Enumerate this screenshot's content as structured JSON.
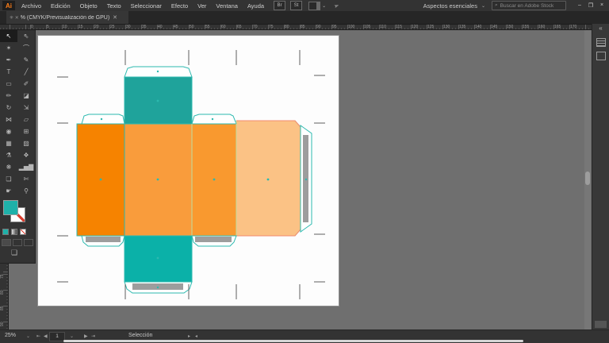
{
  "app": {
    "logo": "Ai"
  },
  "menubar": {
    "items": [
      "Archivo",
      "Edición",
      "Objeto",
      "Texto",
      "Seleccionar",
      "Efecto",
      "Ver",
      "Ventana",
      "Ayuda"
    ],
    "bridge_label": "Br",
    "stock_label": "St",
    "share_glyph": "➣",
    "workspace_chevron": "⌄"
  },
  "workspace": {
    "label": "Aspectos esenciales"
  },
  "search": {
    "magnifier_glyph": "⌕",
    "placeholder": "Buscar en Adobe Stock"
  },
  "window_controls": {
    "minimize": "–",
    "restore": "❐",
    "close": "×"
  },
  "tab": {
    "prefix": "✳ ✕",
    "title": "% (CMYK/Previsualización de GPU)",
    "close": "✕"
  },
  "rulers": {
    "horizontal": [
      0,
      5,
      10,
      15,
      20,
      25,
      30,
      35,
      40,
      45,
      50,
      55,
      60,
      65,
      70,
      75,
      80,
      85,
      90,
      95,
      100,
      105,
      110,
      115,
      120,
      125,
      130,
      135,
      140,
      145,
      150,
      155,
      160,
      165,
      170
    ],
    "vertical": [
      75,
      80,
      85,
      90
    ]
  },
  "toolbar": {
    "tools": [
      {
        "name": "selection",
        "glyph": "↖",
        "selected": true
      },
      {
        "name": "direct-selection",
        "glyph": "⇖"
      },
      {
        "name": "magic-wand",
        "glyph": "✶"
      },
      {
        "name": "lasso",
        "glyph": "⌒"
      },
      {
        "name": "pen",
        "glyph": "✒"
      },
      {
        "name": "curvature",
        "glyph": "✎"
      },
      {
        "name": "type",
        "glyph": "T"
      },
      {
        "name": "line-segment",
        "glyph": "╱"
      },
      {
        "name": "rectangle",
        "glyph": "▭"
      },
      {
        "name": "paintbrush",
        "glyph": "✐"
      },
      {
        "name": "pencil",
        "glyph": "✏"
      },
      {
        "name": "eraser",
        "glyph": "◪"
      },
      {
        "name": "rotate",
        "glyph": "↻"
      },
      {
        "name": "scale",
        "glyph": "⇲"
      },
      {
        "name": "width",
        "glyph": "⋈"
      },
      {
        "name": "free-transform",
        "glyph": "▱"
      },
      {
        "name": "shape-builder",
        "glyph": "◉"
      },
      {
        "name": "perspective-grid",
        "glyph": "⊞"
      },
      {
        "name": "mesh",
        "glyph": "▦"
      },
      {
        "name": "gradient",
        "glyph": "▨"
      },
      {
        "name": "eyedropper",
        "glyph": "⚗"
      },
      {
        "name": "blend",
        "glyph": "❖"
      },
      {
        "name": "symbol-sprayer",
        "glyph": "❋"
      },
      {
        "name": "column-graph",
        "glyph": "▂▅▇"
      },
      {
        "name": "artboard",
        "glyph": "❏"
      },
      {
        "name": "slice",
        "glyph": "✄"
      },
      {
        "name": "hand",
        "glyph": "☛"
      },
      {
        "name": "zoom",
        "glyph": "⚲"
      }
    ]
  },
  "dock": {
    "collapse_glyph": "«"
  },
  "statusbar": {
    "zoom_level": "25%",
    "zoom_chevron": "⌄",
    "first_glyph": "⇤",
    "prev_glyph": "◀",
    "artboard_number": "1",
    "artboard_chevron": "⌄",
    "next_glyph": "▶",
    "last_glyph": "⇥",
    "status_label": "Selección",
    "fwd_glyph": "▸",
    "back_glyph": "◂"
  },
  "colors": {
    "teal_lid": "#1FA39B",
    "teal_bottom": "#0BB1A8",
    "teal_outline": "#2CB9AF",
    "teal_swatch": "#1FB1A9",
    "orange1": "#F68300",
    "orange2": "#F99C3C",
    "orange3": "#F9992F",
    "orange4": "#FBC285",
    "salmon": "#F28A70",
    "fold_green": "#BFDE9E",
    "gray_bar": "#9D9D9D",
    "crop_mark": "#5F5F5F",
    "flap_white": "#FFFFFF"
  }
}
